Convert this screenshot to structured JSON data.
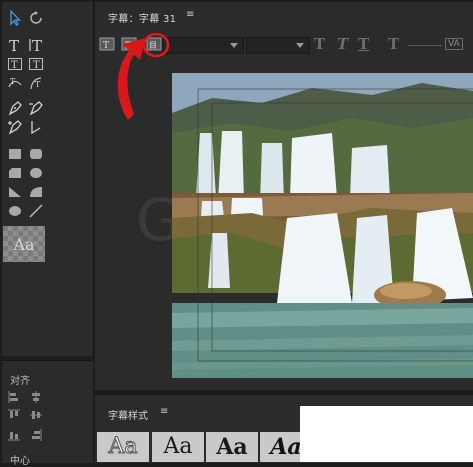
{
  "title_panel": {
    "title": "字幕：字幕 31",
    "menu_glyph": "≡"
  },
  "toolbar": {
    "font_family_value": "",
    "font_style_value": "",
    "bold_glyph": "T",
    "italic_glyph": "T",
    "underline_glyph": "T",
    "kerning_glyph": "T",
    "va_label": "VA"
  },
  "tools": {
    "items": [
      "selection-tool",
      "rotation-tool",
      "type-tool",
      "vertical-type-tool",
      "area-type-tool",
      "vertical-area-type-tool",
      "path-type-tool",
      "vertical-path-type-tool",
      "pen-tool",
      "delete-anchor-tool",
      "add-anchor-tool",
      "convert-anchor-tool",
      "rectangle-tool",
      "rounded-rectangle-tool",
      "clipped-corner-rectangle-tool",
      "rounded-corner-rectangle-tool",
      "wedge-tool",
      "arc-tool",
      "ellipse-tool",
      "line-tool"
    ],
    "style_swatch_text": "Aa"
  },
  "align_panel": {
    "title": "对齐",
    "center_label": "中心"
  },
  "canvas": {
    "watermark": "G"
  },
  "style_panel": {
    "title": "字幕样式",
    "menu_glyph": "≡",
    "samples": [
      "Aa",
      "Aa",
      "Aa",
      "Aa"
    ]
  },
  "colors": {
    "panel_bg": "#2b2b2b",
    "accent_blue": "#4a8fd9",
    "annotation_red": "#e01a1a"
  }
}
